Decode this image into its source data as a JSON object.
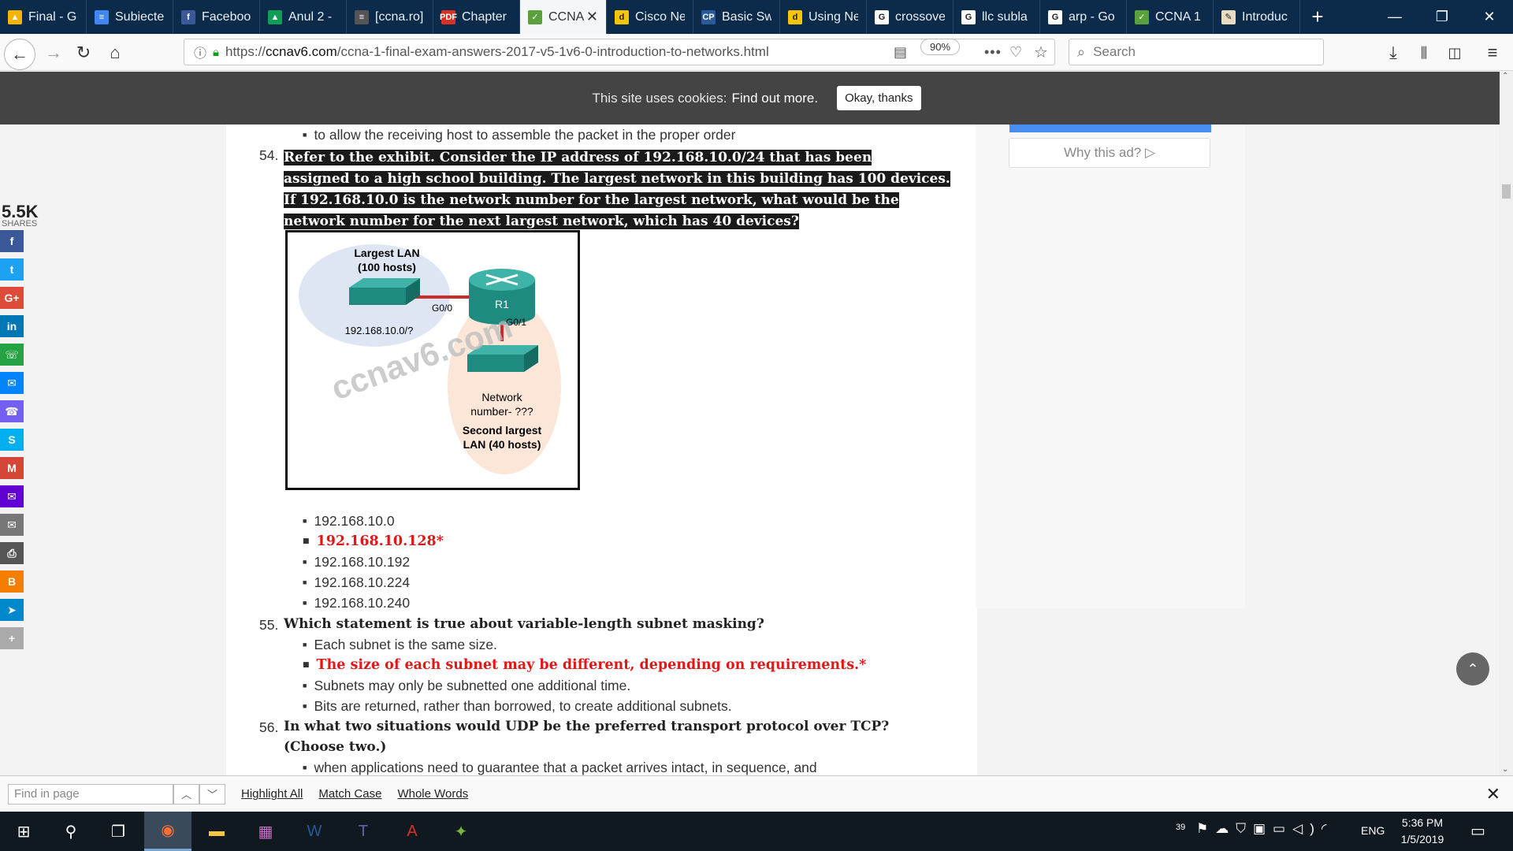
{
  "tabs": [
    {
      "label": "Final - G",
      "fav_color": "#f4b400",
      "fav_char": "▲"
    },
    {
      "label": "Subiecte",
      "fav_color": "#4285f4",
      "fav_char": "≡"
    },
    {
      "label": "Faceboo",
      "fav_color": "#3b5998",
      "fav_char": "f"
    },
    {
      "label": "Anul 2 -",
      "fav_color": "#0f9d58",
      "fav_char": "▲"
    },
    {
      "label": "[ccna.ro]",
      "fav_color": "#555555",
      "fav_char": "≡"
    },
    {
      "label": "Chapter",
      "fav_color": "#d93025",
      "fav_char": "PDF"
    },
    {
      "label": "CCNA",
      "fav_color": "#5aa03c",
      "fav_char": "✓"
    },
    {
      "label": "Cisco Ne",
      "fav_color": "#f7c600",
      "fav_char": "d"
    },
    {
      "label": "Basic Sw",
      "fav_color": "#2a5a9c",
      "fav_char": "CP"
    },
    {
      "label": "Using Ne",
      "fav_color": "#f7c600",
      "fav_char": "d"
    },
    {
      "label": "crossove",
      "fav_color": "#ffffff",
      "fav_char": "G"
    },
    {
      "label": "llc subla",
      "fav_color": "#ffffff",
      "fav_char": "G"
    },
    {
      "label": "arp - Go",
      "fav_color": "#ffffff",
      "fav_char": "G"
    },
    {
      "label": "CCNA 1",
      "fav_color": "#5aa03c",
      "fav_char": "✓"
    },
    {
      "label": "Introduc",
      "fav_color": "#e9dcc0",
      "fav_char": "✎"
    }
  ],
  "url": {
    "prefix": "https://",
    "host": "ccnav6.com",
    "path": "/ccna-1-final-exam-answers-2017-v5-1v6-0-introduction-to-networks.html"
  },
  "zoom": "90%",
  "search_placeholder": "Search",
  "cookie": {
    "text": "This site uses cookies:",
    "link": "Find out more.",
    "button": "Okay, thanks"
  },
  "ad": {
    "why": "Why this ad? ▷"
  },
  "share": {
    "count": "5.5K",
    "label": "SHARES"
  },
  "share_buttons": [
    {
      "name": "facebook",
      "color": "#3b5998",
      "glyph": "f"
    },
    {
      "name": "twitter",
      "color": "#1da1f2",
      "glyph": "t"
    },
    {
      "name": "google-plus",
      "color": "#dd4b39",
      "glyph": "G+"
    },
    {
      "name": "linkedin",
      "color": "#0077b5",
      "glyph": "in"
    },
    {
      "name": "whatsapp",
      "color": "#25a244",
      "glyph": "☏"
    },
    {
      "name": "messenger",
      "color": "#0084ff",
      "glyph": "✉"
    },
    {
      "name": "viber",
      "color": "#7360f2",
      "glyph": "☎"
    },
    {
      "name": "skype",
      "color": "#00aff0",
      "glyph": "S"
    },
    {
      "name": "gmail",
      "color": "#d44638",
      "glyph": "M"
    },
    {
      "name": "yahoo-mail",
      "color": "#6001d2",
      "glyph": "✉"
    },
    {
      "name": "email",
      "color": "#777777",
      "glyph": "✉"
    },
    {
      "name": "print",
      "color": "#555555",
      "glyph": "⎙"
    },
    {
      "name": "blogger",
      "color": "#f57d00",
      "glyph": "B"
    },
    {
      "name": "telegram",
      "color": "#0088cc",
      "glyph": "➤"
    },
    {
      "name": "more",
      "color": "#aaaaaa",
      "glyph": "+"
    }
  ],
  "prev_option": "to allow the receiving host to assemble the packet in the proper order",
  "q54": {
    "num": "54.",
    "lines": [
      "Refer to the exhibit. Consider the IP address of 192.168.10.0/24 that has been",
      "assigned to a high school building. The largest network in this building has 100 devices.",
      "If 192.168.10.0 is the network number for the largest network, what would be the",
      "network number for the next largest network, which has 40 devices?"
    ],
    "options": [
      "192.168.10.0",
      "192.168.10.128*",
      "192.168.10.192",
      "192.168.10.224",
      "192.168.10.240"
    ],
    "correct_index": 1
  },
  "exhibit": {
    "lan1_title": "Largest LAN",
    "lan1_hosts": "(100 hosts)",
    "lan1_net": "192.168.10.0/?",
    "g00": "G0/0",
    "g01": "G0/1",
    "router": "R1",
    "lan2_net1": "Network",
    "lan2_net2": "number- ???",
    "lan2_title": "Second largest",
    "lan2_hosts": "LAN (40 hosts)",
    "watermark": "ccnav6.com"
  },
  "q55": {
    "num": "55.",
    "text": "Which statement is true about variable-length subnet masking?",
    "options": [
      "Each subnet is the same size.",
      "The size of each subnet may be different, depending on requirements.*",
      "Subnets may only be subnetted one additional time.",
      "Bits are returned, rather than borrowed, to create additional subnets."
    ],
    "correct_index": 1
  },
  "q56": {
    "num": "56.",
    "line1": "In what two situations would UDP be the preferred transport protocol over TCP?",
    "line2": "(Choose two.)",
    "option1": "when applications need to guarantee that a packet arrives intact, in sequence, and"
  },
  "findbar": {
    "placeholder": "Find in page",
    "highlight": "Highlight All",
    "match_case": "Match Case",
    "whole_words": "Whole Words"
  },
  "taskbar": {
    "time": "5:36 PM",
    "date": "1/5/2019",
    "lang": "ENG",
    "tray_count": "39"
  }
}
